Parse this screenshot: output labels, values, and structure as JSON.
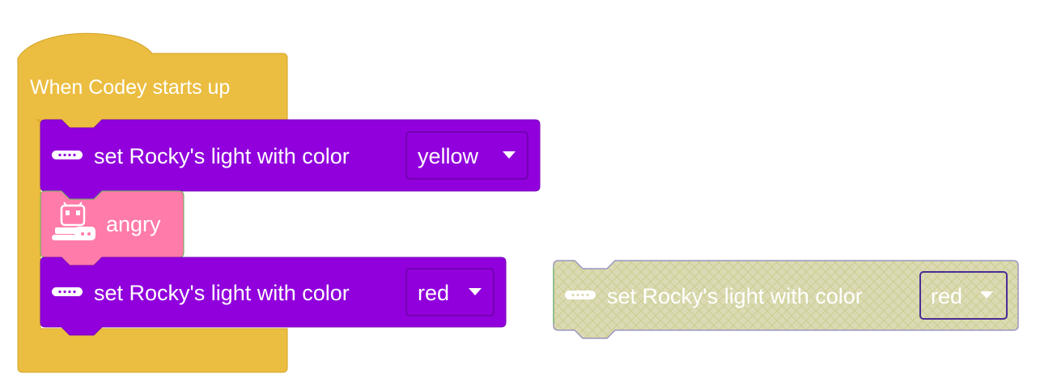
{
  "workspace": {
    "hat_block": {
      "label": "When Codey starts up",
      "color": "#ebbd40"
    },
    "stack": [
      {
        "label": "set Rocky's light with color",
        "dropdown_value": "yellow",
        "icon": "rocky-light-icon",
        "color": "#9100dc"
      },
      {
        "label": "angry",
        "icon": "codey-rocky-robot-icon",
        "color": "#ff7ba9"
      },
      {
        "label": "set Rocky's light with color",
        "dropdown_value": "red",
        "icon": "rocky-light-icon",
        "color": "#9100dc"
      }
    ],
    "detached_block": {
      "label": "set Rocky's light with color",
      "dropdown_value": "red",
      "icon": "rocky-light-icon",
      "state": "disabled",
      "color": "#dad9b0"
    }
  }
}
